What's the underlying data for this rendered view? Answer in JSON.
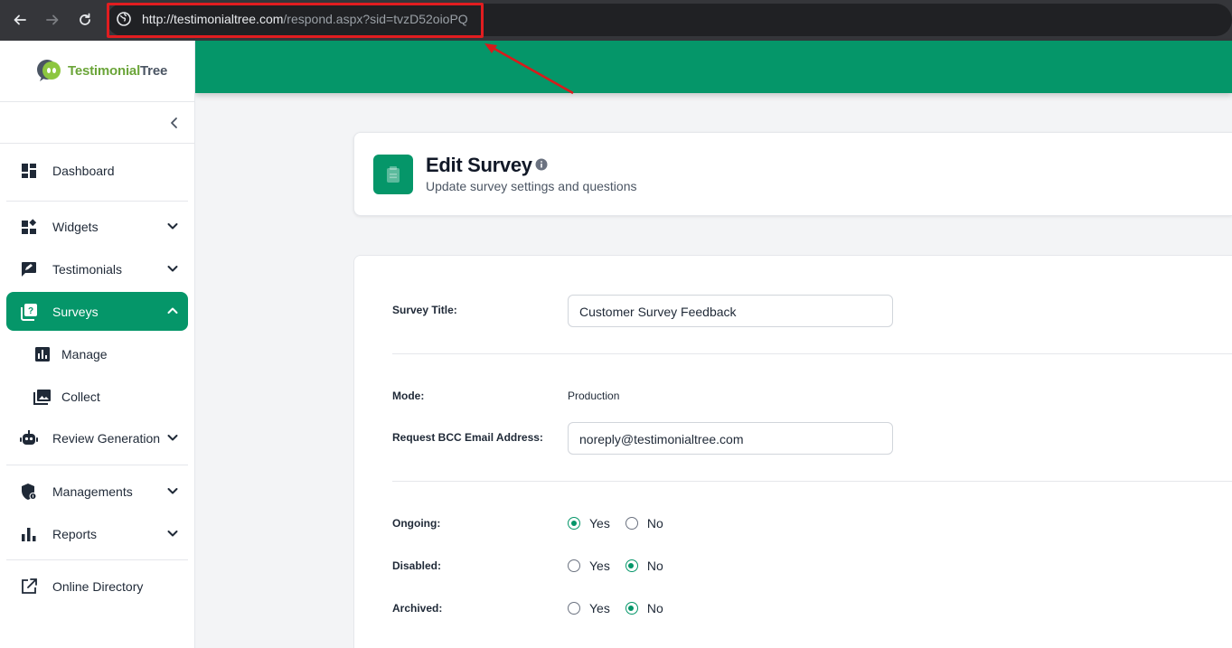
{
  "browser": {
    "url_domain": "http://testimonialtree.com",
    "url_path": "/respond.aspx?sid=tvzD52oioPQ",
    "icons": [
      "back-icon",
      "forward-icon",
      "reload-icon",
      "globe-icon"
    ]
  },
  "brand": {
    "logo_part1": "Testimonial",
    "logo_part2": "Tree",
    "accent": "#059669",
    "logo_green": "#6ba539"
  },
  "sidebar": {
    "items": [
      {
        "label": "Dashboard",
        "icon": "dashboard-icon"
      },
      {
        "label": "Widgets",
        "icon": "widgets-icon"
      },
      {
        "label": "Testimonials",
        "icon": "testimonials-icon"
      },
      {
        "label": "Surveys",
        "icon": "surveys-icon"
      },
      {
        "label": "Review Generation",
        "icon": "robot-icon"
      },
      {
        "label": "Managements",
        "icon": "shield-user-icon"
      },
      {
        "label": "Reports",
        "icon": "bar-chart-icon"
      },
      {
        "label": "Online Directory",
        "icon": "external-link-icon"
      }
    ],
    "sub_items": [
      {
        "label": "Manage",
        "icon": "chart-square-icon"
      },
      {
        "label": "Collect",
        "icon": "images-icon"
      }
    ]
  },
  "header": {
    "title": "Edit Survey",
    "subtitle": "Update survey settings and questions"
  },
  "form": {
    "survey_title_label": "Survey Title:",
    "survey_title_value": "Customer Survey Feedback",
    "mode_label": "Mode:",
    "mode_value": "Production",
    "bcc_label": "Request BCC Email Address:",
    "bcc_value": "noreply@testimonialtree.com",
    "ongoing_label": "Ongoing:",
    "disabled_label": "Disabled:",
    "archived_label": "Archived:",
    "yes_label": "Yes",
    "no_label": "No",
    "ongoing": "Yes",
    "disabled": "No",
    "archived": "No"
  }
}
